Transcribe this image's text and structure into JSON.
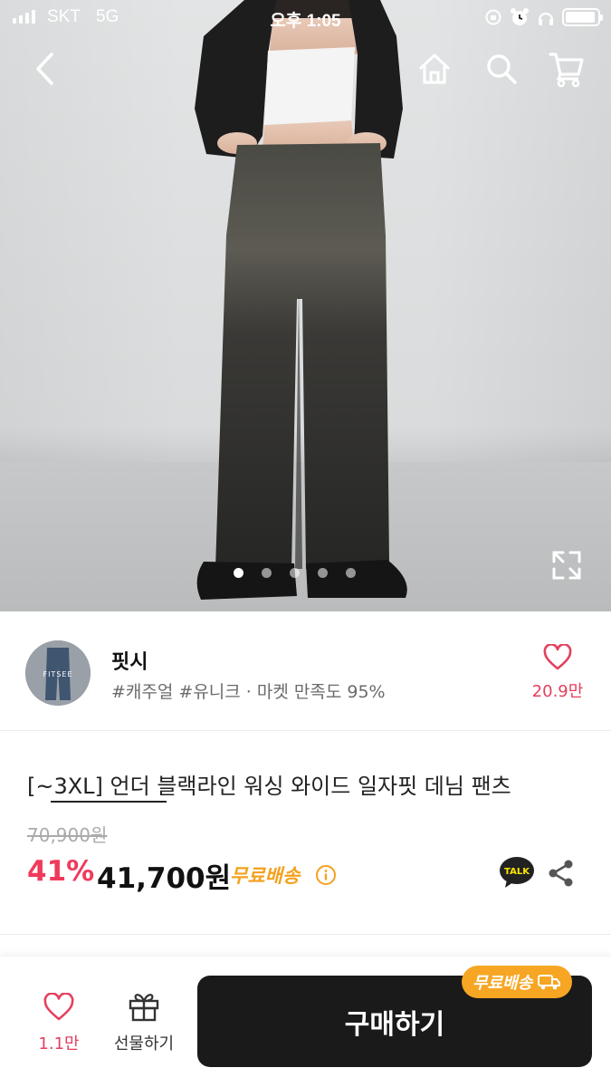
{
  "status_bar": {
    "carrier": "SKT",
    "network": "5G",
    "time": "오후 1:05",
    "battery_level": 0.95
  },
  "nav": {
    "back_icon": "chevron-left-icon",
    "home_icon": "home-icon",
    "search_icon": "search-icon",
    "cart_icon": "cart-icon"
  },
  "gallery": {
    "total_images": 5,
    "active_index": 0
  },
  "shop": {
    "name": "핏시",
    "avatar_text": "FITSEE",
    "tags": "#캐주얼 #유니크 · 마켓 만족도 95%",
    "like_count": "20.9만"
  },
  "product": {
    "title": "[~3XL] 언더 블랙라인 워싱 와이드 일자핏 데님 팬츠",
    "original_price": "70,900원",
    "discount": "41%",
    "price": "41,700원",
    "shipping": "무료배송"
  },
  "bottom_bar": {
    "wish_count": "1.1만",
    "gift_label": "선물하기",
    "buy_label": "구매하기",
    "shipping_badge": "무료배송"
  },
  "colors": {
    "accent_pink": "#f03a5c",
    "shipping_orange": "#f4a11d",
    "buy_button": "#1a1a1a",
    "kakao_yellow": "#fee500"
  }
}
